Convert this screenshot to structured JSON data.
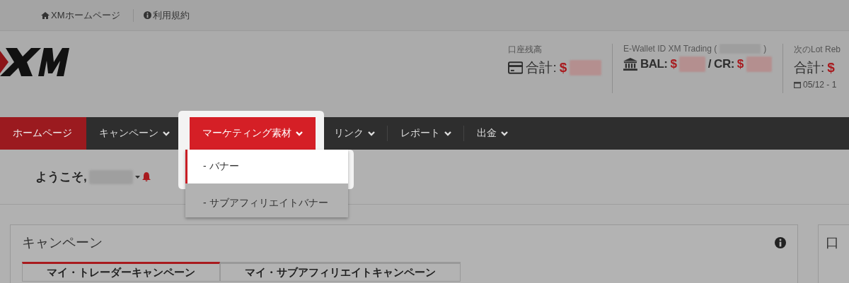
{
  "top_links": [
    {
      "label": "XMホームページ"
    },
    {
      "label": "利用規約"
    }
  ],
  "header": {
    "balance": {
      "label": "口座残高",
      "total_label": "合計:",
      "currency": "$"
    },
    "ewallet": {
      "label_start": "E-Wallet ID XM Trading (",
      "label_end": ")",
      "bal_label": "BAL:",
      "bal_currency": "$",
      "cr_label": "/ CR:",
      "cr_currency": "$"
    },
    "rebate": {
      "label": "次のLot Reb",
      "total_label": "合計:",
      "currency": "$",
      "date": "05/12 - 1"
    }
  },
  "nav": [
    {
      "label": "ホームページ",
      "selected": true,
      "has_menu": false,
      "expanded": false
    },
    {
      "label": "キャンペーン",
      "selected": false,
      "has_menu": true,
      "expanded": false
    },
    {
      "label": "マーケティング素材",
      "selected": false,
      "has_menu": true,
      "expanded": true
    },
    {
      "label": "リンク",
      "selected": false,
      "has_menu": true,
      "expanded": false
    },
    {
      "label": "レポート",
      "selected": false,
      "has_menu": true,
      "expanded": false
    },
    {
      "label": "出金",
      "selected": false,
      "has_menu": true,
      "expanded": false
    }
  ],
  "dropdown": [
    {
      "label": "- バナー",
      "highlighted": true
    },
    {
      "label": "- サブアフィリエイトバナー",
      "highlighted": false
    }
  ],
  "welcome": {
    "label": "ようこそ,"
  },
  "campaign_card": {
    "title": "キャンペーン",
    "tabs": [
      {
        "label": "マイ・トレーダーキャンペーン",
        "selected": true
      },
      {
        "label": "マイ・サブアフィリエイトキャンペーン",
        "selected": false
      }
    ]
  },
  "side_card": {
    "title": "口"
  }
}
